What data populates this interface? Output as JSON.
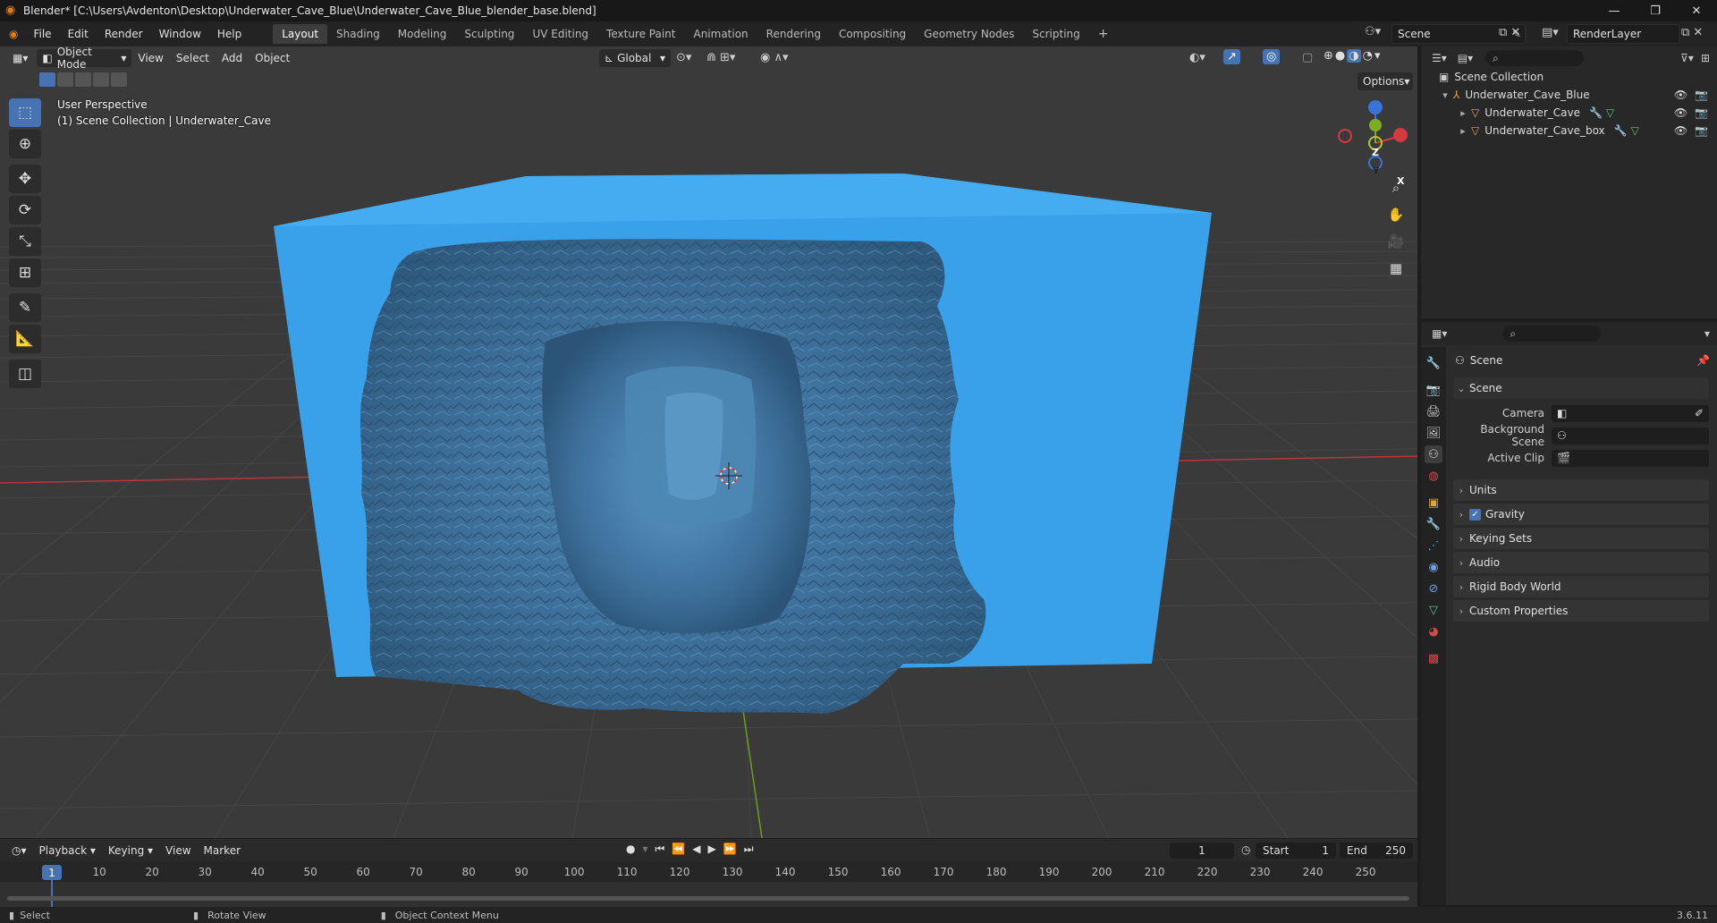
{
  "title_bar": {
    "title": "Blender* [C:\\Users\\Avdenton\\Desktop\\Underwater_Cave_Blue\\Underwater_Cave_Blue_blender_base.blend]"
  },
  "menu": [
    "File",
    "Edit",
    "Render",
    "Window",
    "Help"
  ],
  "workspaces": [
    "Layout",
    "Shading",
    "Modeling",
    "Sculpting",
    "UV Editing",
    "Texture Paint",
    "Animation",
    "Rendering",
    "Compositing",
    "Geometry Nodes",
    "Scripting"
  ],
  "active_workspace": "Layout",
  "scene_selector": {
    "scene": "Scene",
    "view_layer": "RenderLayer"
  },
  "viewport": {
    "mode": "Object Mode",
    "menus": [
      "View",
      "Select",
      "Add",
      "Object"
    ],
    "orientation": "Global",
    "options_label": "Options",
    "overlay_line1": "User Perspective",
    "overlay_line2": "(1) Scene Collection | Underwater_Cave",
    "gizmo": {
      "z": "Z",
      "y": "Y",
      "x": "X"
    },
    "colors": {
      "cube": "#3aa3ec",
      "rock": "#3f6f96",
      "background": "#3a3a3a",
      "x_axis": "#c8363a",
      "y_axis": "#6d9e1c"
    }
  },
  "outliner": {
    "root": "Scene Collection",
    "items": [
      {
        "name": "Underwater_Cave_Blue"
      },
      {
        "name": "Underwater_Cave"
      },
      {
        "name": "Underwater_Cave_box"
      }
    ]
  },
  "properties": {
    "header": "Scene",
    "section": "Scene",
    "fields": [
      {
        "label": "Camera"
      },
      {
        "label": "Background Scene"
      },
      {
        "label": "Active Clip"
      }
    ],
    "panels": [
      "Units",
      "Gravity",
      "Keying Sets",
      "Audio",
      "Rigid Body World",
      "Custom Properties"
    ],
    "gravity_checked": true
  },
  "timeline": {
    "menus": [
      "Playback",
      "Keying",
      "View",
      "Marker"
    ],
    "current_frame": "1",
    "start_label": "Start",
    "start": "1",
    "end_label": "End",
    "end": "250",
    "ticks": [
      "1",
      "10",
      "20",
      "30",
      "40",
      "50",
      "60",
      "70",
      "80",
      "90",
      "100",
      "110",
      "120",
      "130",
      "140",
      "150",
      "160",
      "170",
      "180",
      "190",
      "200",
      "210",
      "220",
      "230",
      "240",
      "250"
    ]
  },
  "status_bar": {
    "select": "Select",
    "rotate": "Rotate View",
    "context": "Object Context Menu",
    "version": "3.6.11"
  }
}
